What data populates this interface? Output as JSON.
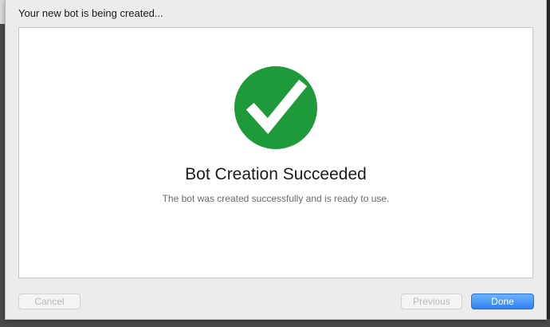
{
  "dialog": {
    "title": "Your new bot is being created..."
  },
  "status": {
    "icon": "checkmark-circle-icon",
    "icon_color": "#1f9a3b",
    "headline": "Bot Creation Succeeded",
    "message": "The bot was created successfully and is ready to use."
  },
  "buttons": {
    "cancel_label": "Cancel",
    "previous_label": "Previous",
    "done_label": "Done"
  },
  "colors": {
    "accent": "#2f7ff2",
    "success": "#1f9a3b"
  }
}
